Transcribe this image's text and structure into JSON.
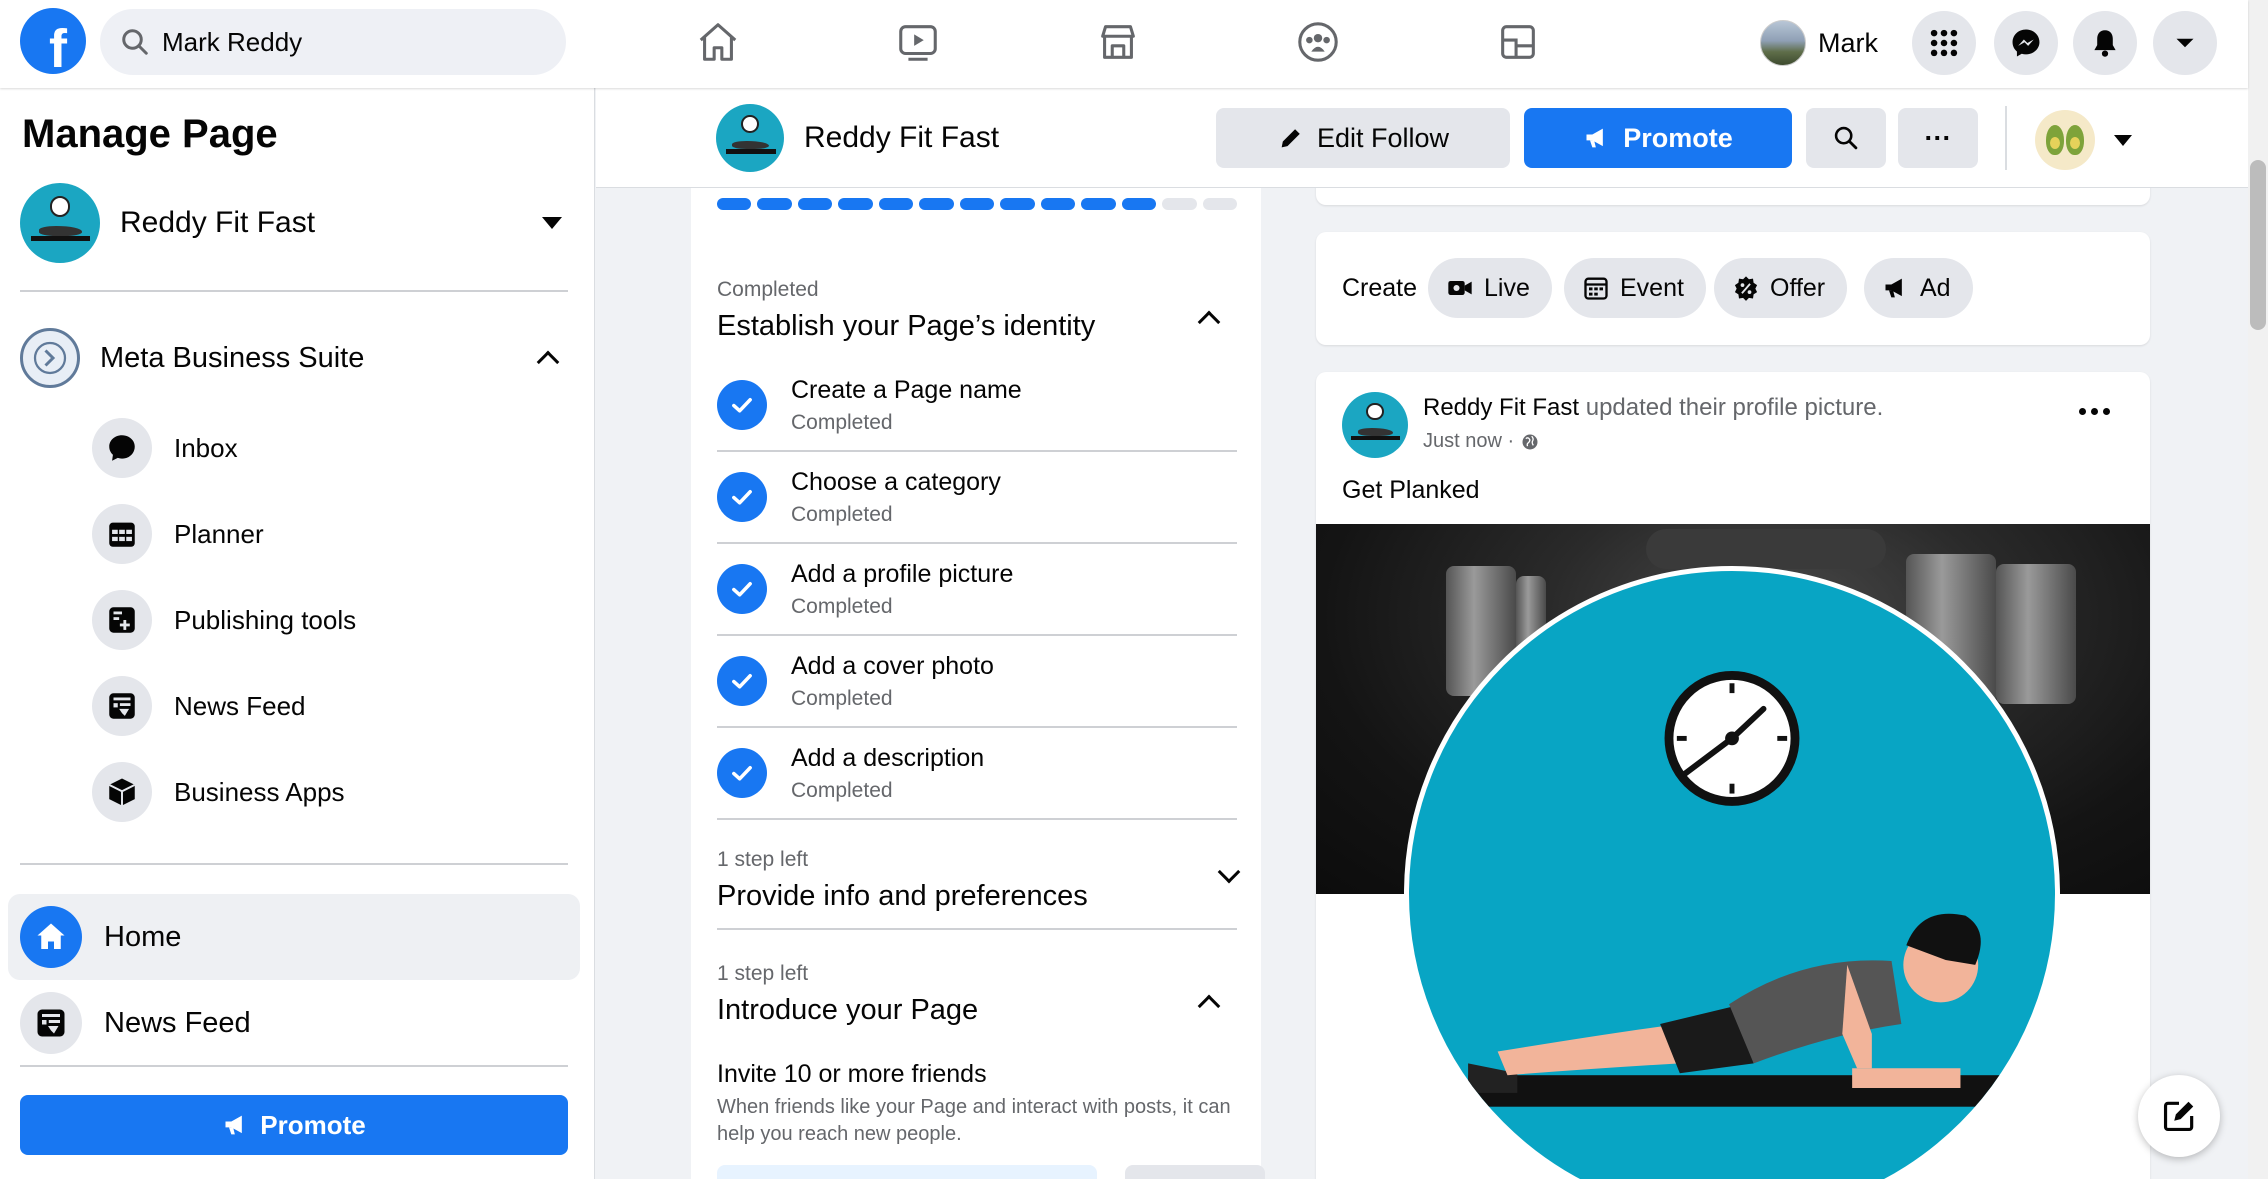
{
  "topbar": {
    "logo": "f",
    "search_value": "Mark Reddy",
    "nav_icons": [
      "home-icon",
      "watch-icon",
      "marketplace-icon",
      "groups-icon",
      "gaming-icon"
    ],
    "profile_name": "Mark"
  },
  "sidebar": {
    "title": "Manage Page",
    "page_name": "Reddy Fit Fast",
    "suite_label": "Meta Business Suite",
    "suite_items": [
      {
        "label": "Inbox",
        "icon": "chat-bubble-icon"
      },
      {
        "label": "Planner",
        "icon": "calendar-grid-icon"
      },
      {
        "label": "Publishing tools",
        "icon": "publishing-tools-icon"
      },
      {
        "label": "News Feed",
        "icon": "news-feed-icon"
      },
      {
        "label": "Business Apps",
        "icon": "cube-icon"
      }
    ],
    "home_label": "Home",
    "feed_label": "News Feed",
    "promote_label": "Promote"
  },
  "header": {
    "page_name": "Reddy Fit Fast",
    "edit_follow_label": "Edit Follow",
    "promote_label": "Promote",
    "more_label": "···"
  },
  "checklist": {
    "progress": {
      "completed": 11,
      "total": 13
    },
    "section1": {
      "meta": "Completed",
      "title": "Establish your Page’s identity"
    },
    "tasks": [
      {
        "title": "Create a Page name",
        "status": "Completed"
      },
      {
        "title": "Choose a category",
        "status": "Completed"
      },
      {
        "title": "Add a profile picture",
        "status": "Completed"
      },
      {
        "title": "Add a cover photo",
        "status": "Completed"
      },
      {
        "title": "Add a description",
        "status": "Completed"
      }
    ],
    "section2": {
      "meta": "1 step left",
      "title": "Provide info and preferences"
    },
    "section3": {
      "meta": "1 step left",
      "title": "Introduce your Page"
    },
    "invite_title": "Invite 10 or more friends",
    "invite_desc": "When friends like your Page and interact with posts, it can help you reach new people."
  },
  "create": {
    "label": "Create",
    "pills": [
      {
        "label": "Live",
        "icon": "video-camera-icon"
      },
      {
        "label": "Event",
        "icon": "calendar-icon"
      },
      {
        "label": "Offer",
        "icon": "offer-tag-icon"
      },
      {
        "label": "Ad",
        "icon": "megaphone-icon"
      }
    ]
  },
  "post": {
    "author": "Reddy Fit Fast",
    "action": " updated their profile picture.",
    "time": "Just now ·",
    "text": "Get Planked"
  },
  "colors": {
    "accent": "#1877f2",
    "page_bg": "#f0f2f5",
    "teal": "#08a5c4"
  }
}
